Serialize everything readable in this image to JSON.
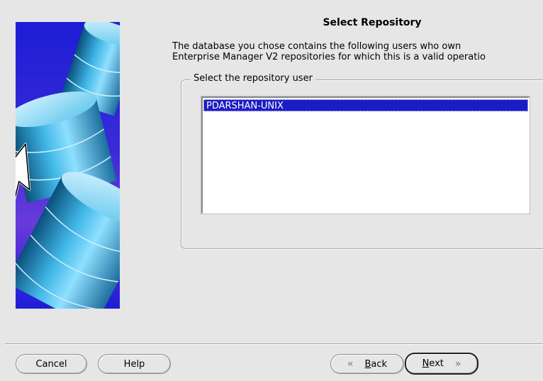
{
  "wizard": {
    "title": "Select Repository",
    "description_line1": "The database you chose contains the following users who own",
    "description_line2": "Enterprise Manager V2 repositories for which this is a valid operatio",
    "group_label": "Select the repository user",
    "repository_users": [
      "PDARSHAN-UNIX"
    ],
    "selected_user": "PDARSHAN-UNIX"
  },
  "buttons": {
    "cancel": "Cancel",
    "help": "Help",
    "back_mnemonic": "B",
    "back_rest": "ack",
    "next_mnemonic": "N",
    "next_rest": "ext"
  },
  "icons": {
    "back": "chevron-left-double-icon",
    "next": "chevron-right-double-icon",
    "art": "database-cylinders-cursor-illustration"
  },
  "colors": {
    "background": "#e6e6e6",
    "selection": "#1c1cc4",
    "art_background": "#1d1dd6"
  }
}
